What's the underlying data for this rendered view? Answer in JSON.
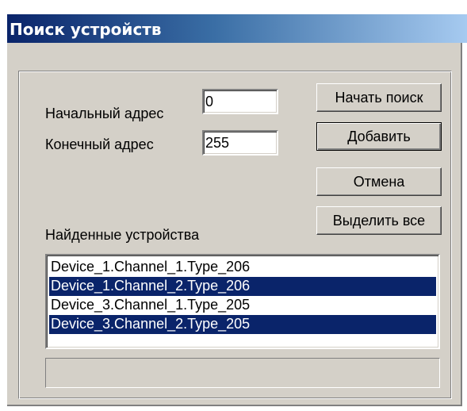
{
  "window": {
    "title": "Поиск устройств"
  },
  "form": {
    "start_address_label": "Начальный адрес",
    "start_address_value": "0",
    "end_address_label": "Конечный адрес",
    "end_address_value": "255",
    "found_devices_label": "Найденные устройства"
  },
  "buttons": {
    "start_search": "Начать поиск",
    "add": "Добавить",
    "cancel": "Отмена",
    "select_all": "Выделить все"
  },
  "devices": [
    {
      "label": "Device_1.Channel_1.Type_206",
      "selected": false
    },
    {
      "label": "Device_1.Channel_2.Type_206",
      "selected": true
    },
    {
      "label": "Device_3.Channel_1.Type_205",
      "selected": false
    },
    {
      "label": "Device_3.Channel_2.Type_205",
      "selected": true
    }
  ],
  "colors": {
    "selection": "#0a246a",
    "dialog_face": "#d4d0c8"
  }
}
